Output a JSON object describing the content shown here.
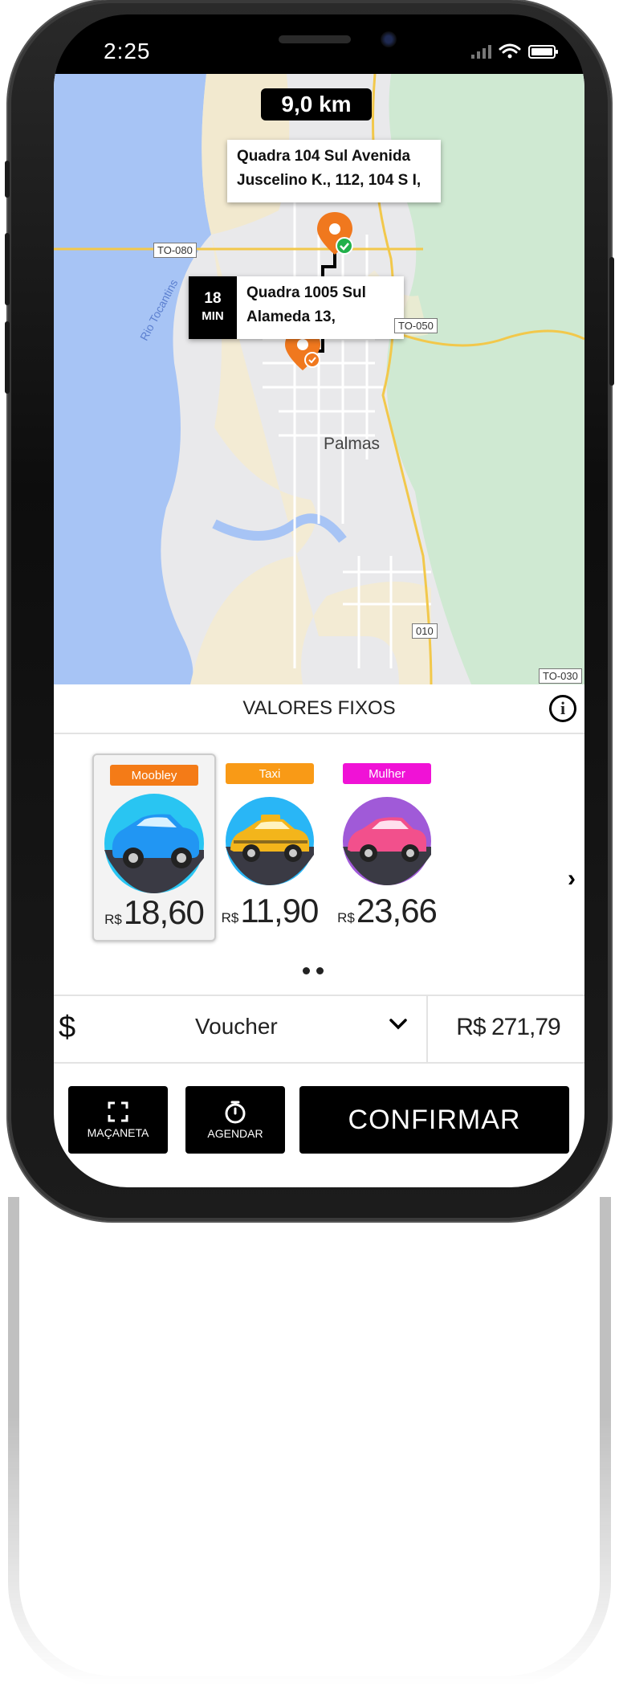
{
  "status_bar": {
    "time": "2:25"
  },
  "map": {
    "distance": "9,0 km",
    "origin_address_line1": "Quadra 104 Sul Avenida",
    "origin_address_line2": "Juscelino K., 112, 104 S I,",
    "eta_value": "18",
    "eta_unit": "MIN",
    "destination_address_line1": "Quadra 1005 Sul",
    "destination_address_line2": "Alameda 13,",
    "city_label": "Palmas",
    "river_label": "Rio Tocantins",
    "road_labels": [
      "TO-080",
      "TO-050",
      "010",
      "TO-030"
    ],
    "colors": {
      "water": "#a7c4f5",
      "land": "#f4ebd1",
      "park": "#cfe9d2",
      "marker": "#f0781e",
      "check": "#22b04b"
    }
  },
  "panel": {
    "title": "VALORES FIXOS",
    "info_icon": "info-icon",
    "categories": [
      {
        "badge": "Moobley",
        "badge_color": "#f47b17",
        "currency": "R$",
        "price": "18,60",
        "selected": true,
        "car_color": "#2196f3",
        "circle_color": "#29c5f2"
      },
      {
        "badge": "Taxi",
        "badge_color": "#f99a16",
        "currency": "R$",
        "price": "11,90",
        "selected": false,
        "car_color": "#f3b51b",
        "circle_color": "#29b6f6"
      },
      {
        "badge": "Mulher",
        "badge_color": "#f012d6",
        "currency": "R$",
        "price": "23,66",
        "selected": false,
        "car_color": "#f2508c",
        "circle_color": "#a05ad8"
      }
    ],
    "pagination_count": 2
  },
  "payment": {
    "currency_icon": "$",
    "method": "Voucher",
    "balance": "R$ 271,79"
  },
  "actions": {
    "handle_label": "MAÇANETA",
    "schedule_label": "AGENDAR",
    "confirm_label": "CONFIRMAR"
  }
}
